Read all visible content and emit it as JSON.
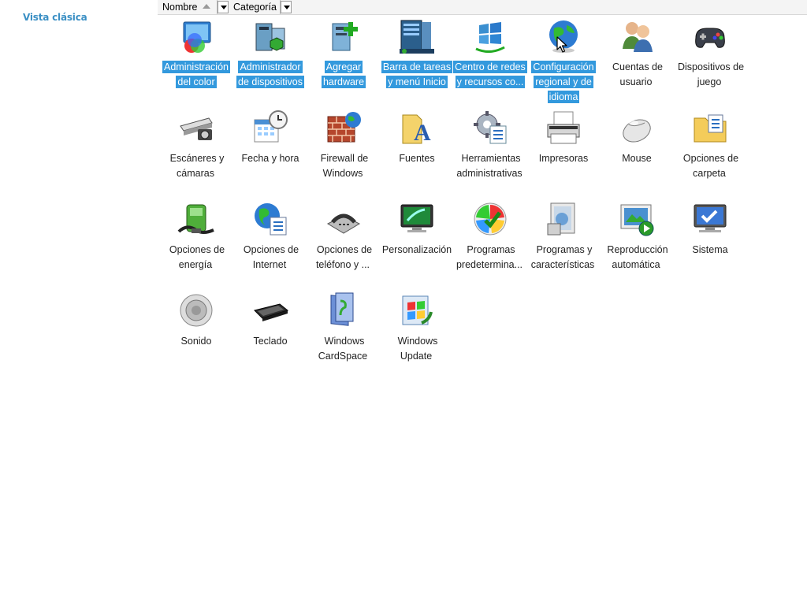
{
  "sidebar": {
    "classic_view_link": "Vista clásica"
  },
  "columns": [
    {
      "label": "Nombre",
      "sorted": "ascending"
    },
    {
      "label": "Categoría"
    }
  ],
  "items": [
    {
      "label": "Administración del color",
      "icon": "color-management-icon",
      "selected": true
    },
    {
      "label": "Administrador de dispositivos",
      "icon": "device-manager-icon",
      "selected": true
    },
    {
      "label": "Agregar hardware",
      "icon": "add-hardware-icon",
      "selected": true
    },
    {
      "label": "Barra de tareas y menú Inicio",
      "icon": "taskbar-start-menu-icon",
      "selected": true
    },
    {
      "label": "Centro de redes y recursos co...",
      "icon": "network-center-icon",
      "selected": true
    },
    {
      "label": "Configuración regional y de idioma",
      "icon": "regional-language-icon",
      "selected": true
    },
    {
      "label": "Cuentas de usuario",
      "icon": "user-accounts-icon",
      "selected": false
    },
    {
      "label": "Dispositivos de juego",
      "icon": "game-controller-icon",
      "selected": false
    },
    {
      "label": "Escáneres y cámaras",
      "icon": "scanner-camera-icon",
      "selected": false
    },
    {
      "label": "Fecha y hora",
      "icon": "date-time-icon",
      "selected": false
    },
    {
      "label": "Firewall de Windows",
      "icon": "firewall-icon",
      "selected": false
    },
    {
      "label": "Fuentes",
      "icon": "fonts-icon",
      "selected": false
    },
    {
      "label": "Herramientas administrativas",
      "icon": "admin-tools-icon",
      "selected": false
    },
    {
      "label": "Impresoras",
      "icon": "printer-icon",
      "selected": false
    },
    {
      "label": "Mouse",
      "icon": "mouse-icon",
      "selected": false
    },
    {
      "label": "Opciones de carpeta",
      "icon": "folder-options-icon",
      "selected": false
    },
    {
      "label": "Opciones de energía",
      "icon": "power-options-icon",
      "selected": false
    },
    {
      "label": "Opciones de Internet",
      "icon": "internet-options-icon",
      "selected": false
    },
    {
      "label": "Opciones de teléfono y ...",
      "icon": "phone-modem-icon",
      "selected": false
    },
    {
      "label": "Personalización",
      "icon": "personalization-icon",
      "selected": false
    },
    {
      "label": "Programas predetermina...",
      "icon": "default-programs-icon",
      "selected": false
    },
    {
      "label": "Programas y características",
      "icon": "programs-features-icon",
      "selected": false
    },
    {
      "label": "Reproducción automática",
      "icon": "autoplay-icon",
      "selected": false
    },
    {
      "label": "Sistema",
      "icon": "system-icon",
      "selected": false
    },
    {
      "label": "Sonido",
      "icon": "sound-icon",
      "selected": false
    },
    {
      "label": "Teclado",
      "icon": "keyboard-icon",
      "selected": false
    },
    {
      "label": "Windows CardSpace",
      "icon": "cardspace-icon",
      "selected": false
    },
    {
      "label": "Windows Update",
      "icon": "windows-update-icon",
      "selected": false
    }
  ],
  "colors": {
    "selection": "#3399dd",
    "link": "#3a8fc4"
  }
}
